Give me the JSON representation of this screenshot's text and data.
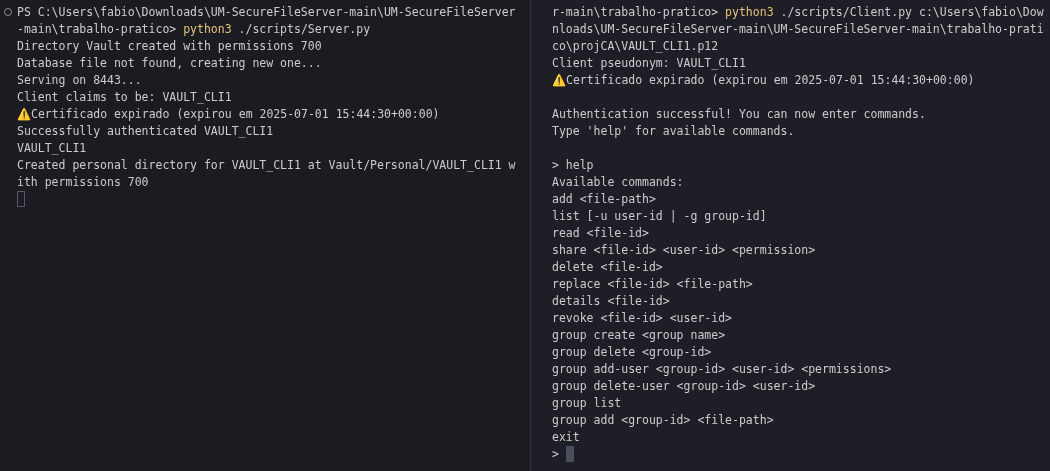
{
  "panes": [
    {
      "lines": [
        {
          "kind": "command",
          "prompt": "PS C:\\Users\\fabio\\Downloads\\UM-SecureFileServer-main\\UM-SecureFileServer-main\\trabalho-pratico> ",
          "program": "python3",
          "args": " ./scripts/Server.py"
        },
        {
          "kind": "output",
          "text": "Directory Vault created with permissions 700"
        },
        {
          "kind": "output",
          "text": "Database file not found, creating new one..."
        },
        {
          "kind": "output",
          "text": "Serving on 8443..."
        },
        {
          "kind": "output",
          "text": "Client claims to be: VAULT_CLI1"
        },
        {
          "kind": "output",
          "text": "⚠️Certificado expirado (expirou em 2025-07-01 15:44:30+00:00)"
        },
        {
          "kind": "output",
          "text": "Successfully authenticated VAULT_CLI1"
        },
        {
          "kind": "output",
          "text": "VAULT_CLI1"
        },
        {
          "kind": "output",
          "text": "Created personal directory for VAULT_CLI1 at Vault/Personal/VAULT_CLI1 with permissions 700"
        },
        {
          "kind": "cursor",
          "focused": false
        }
      ]
    },
    {
      "lines": [
        {
          "kind": "command",
          "prompt": "r-main\\trabalho-pratico> ",
          "program": "python3",
          "args": " ./scripts/Client.py c:\\Users\\fabio\\Downloads\\UM-SecureFileServer-main\\UM-SecureFileServer-main\\trabalho-pratico\\projCA\\VAULT_CLI1.p12"
        },
        {
          "kind": "output",
          "text": "Client pseudonym: VAULT_CLI1"
        },
        {
          "kind": "output",
          "text": "⚠️Certificado expirado (expirou em 2025-07-01 15:44:30+00:00)"
        },
        {
          "kind": "blank"
        },
        {
          "kind": "output",
          "text": "Authentication successful! You can now enter commands."
        },
        {
          "kind": "output",
          "text": "Type 'help' for available commands."
        },
        {
          "kind": "blank"
        },
        {
          "kind": "input",
          "prompt": ">",
          "value": "help"
        },
        {
          "kind": "output",
          "text": "Available commands:"
        },
        {
          "kind": "output",
          "text": "add <file-path>"
        },
        {
          "kind": "output",
          "text": "list [-u user-id | -g group-id]"
        },
        {
          "kind": "output",
          "text": "read <file-id>"
        },
        {
          "kind": "output",
          "text": "share <file-id> <user-id> <permission>"
        },
        {
          "kind": "output",
          "text": "delete <file-id>"
        },
        {
          "kind": "output",
          "text": "replace <file-id> <file-path>"
        },
        {
          "kind": "output",
          "text": "details <file-id>"
        },
        {
          "kind": "output",
          "text": "revoke <file-id> <user-id>"
        },
        {
          "kind": "output",
          "text": "group create <group name>"
        },
        {
          "kind": "output",
          "text": "group delete <group-id>"
        },
        {
          "kind": "output",
          "text": "group add-user <group-id> <user-id> <permissions>"
        },
        {
          "kind": "output",
          "text": "group delete-user <group-id> <user-id>"
        },
        {
          "kind": "output",
          "text": "group list"
        },
        {
          "kind": "output",
          "text": "group add <group-id> <file-path>"
        },
        {
          "kind": "output",
          "text": "exit"
        },
        {
          "kind": "prompt",
          "prompt": ">",
          "focused": true
        }
      ]
    }
  ]
}
